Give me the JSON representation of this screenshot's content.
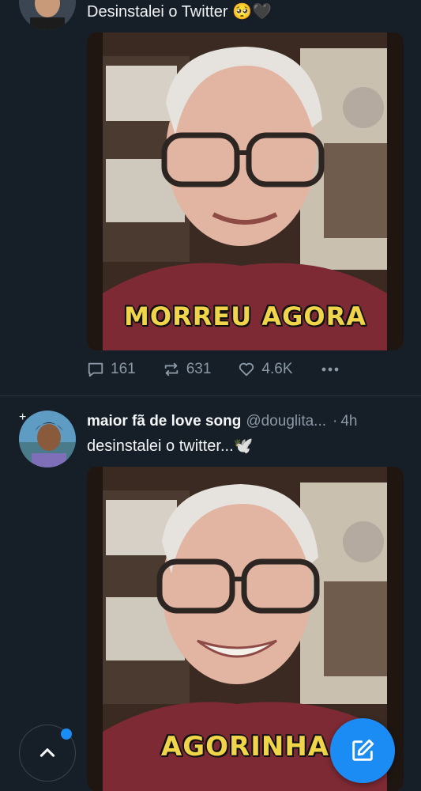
{
  "post1": {
    "text": "Desinstalei o Twitter 🥺🖤",
    "caption": "MORREU AGORA",
    "replies": "161",
    "reposts": "631",
    "likes": "4.6K"
  },
  "post2": {
    "display_name": "maior fã de love song",
    "handle": "@douglita...",
    "time": "4h",
    "text": "desinstalei o twitter...🕊️",
    "caption": "AGORINHA"
  },
  "icons": {
    "reply": "reply-icon",
    "repost": "repost-icon",
    "like": "heart-icon",
    "more": "more-icon",
    "compose": "compose-icon",
    "scroll_top": "chevron-up-icon"
  },
  "colors": {
    "background": "#161e27",
    "accent": "#1c8cf5",
    "muted": "#8c99a6",
    "caption": "#f0d54a"
  }
}
